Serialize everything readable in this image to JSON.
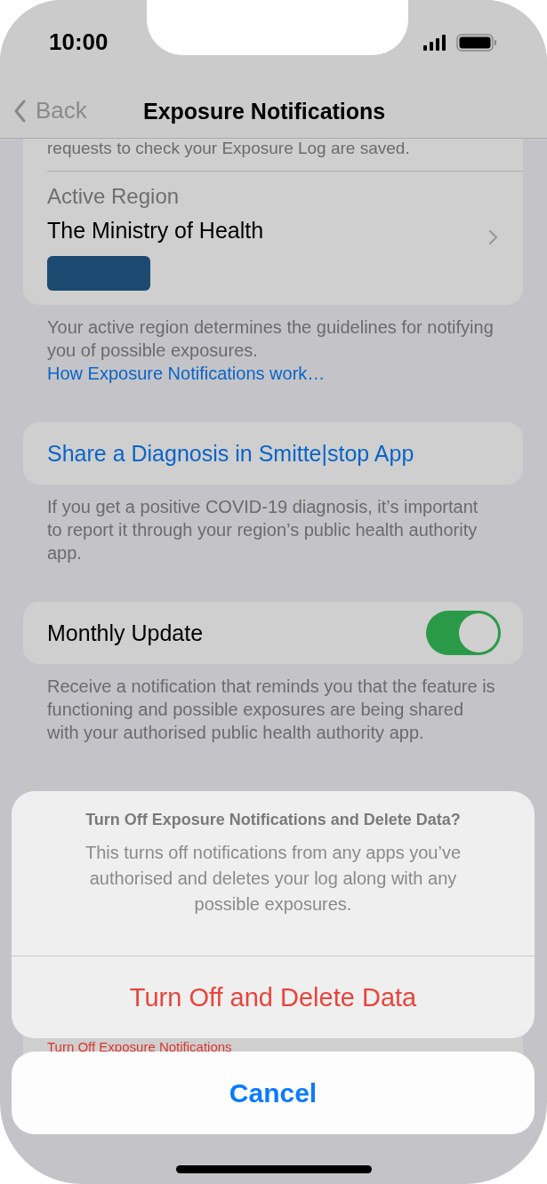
{
  "status_bar": {
    "time": "10:00"
  },
  "nav": {
    "back": "Back",
    "title": "Exposure Notifications"
  },
  "region_card": {
    "note": "requests to check your Exposure Log are saved.",
    "label": "Active Region",
    "value": "The Ministry of Health"
  },
  "region_footer": {
    "text": "Your active region determines the guidelines for notifying you of possible exposures.",
    "link": "How Exposure Notifications work…"
  },
  "share": {
    "label": "Share a Diagnosis in Smitte|stop App",
    "footer": "If you get a positive COVID-19 diagnosis, it’s important to report it through your region’s public health authority app."
  },
  "monthly_update": {
    "label": "Monthly Update",
    "on": true,
    "footer": "Receive a notification that reminds you that the feature is functioning and possible exposures are being shared with your authorised public health authority app."
  },
  "covered_action": "Turn Off Exposure Notifications",
  "sheet": {
    "title": "Turn Off Exposure Notifications and Delete Data?",
    "message": "This turns off notifications from any apps you’ve authorised and deletes your log along with any possible exposures.",
    "actions": [
      {
        "label": "Turn Off and Delete Data",
        "kind": "destructive"
      }
    ],
    "cancel": "Cancel"
  }
}
